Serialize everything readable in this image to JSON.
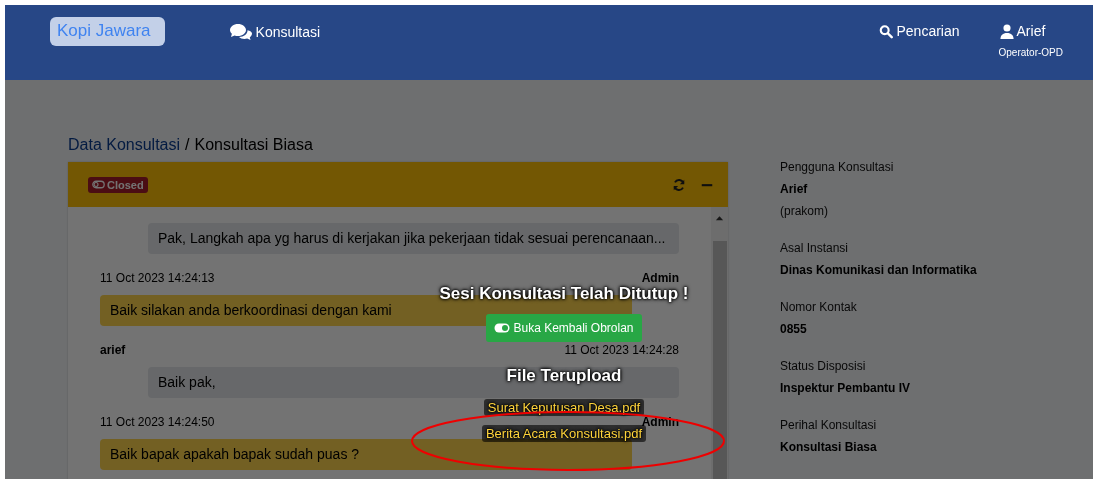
{
  "navbar": {
    "brand": "Kopi Jawara",
    "nav": [
      {
        "label": "Konsultasi",
        "kind": "chat"
      }
    ],
    "search": {
      "label": "Pencarian"
    },
    "user": {
      "name": "Arief",
      "role": "Operator-OPD"
    }
  },
  "breadcrumb": {
    "parent": "Data Konsultasi",
    "separator": "/",
    "current": "Konsultasi Biasa"
  },
  "card": {
    "status": {
      "label": "Closed",
      "kind": "closed"
    },
    "messages": [
      {
        "kind": "user",
        "text": "Pak, Langkah apa yg harus di kerjakan jika pekerjaan tidak sesuai perencanaan..."
      },
      {
        "kind": "admin",
        "sender": "Admin",
        "time": "11 Oct 2023 14:24:13",
        "text": "Baik silakan anda berkoordinasi dengan kami"
      },
      {
        "kind": "user",
        "sender": "arief",
        "time": "11 Oct 2023 14:24:28",
        "text": "Baik pak,"
      },
      {
        "kind": "admin",
        "sender": "Admin",
        "time": "11 Oct 2023 14:24:50",
        "text": "Baik bapak apakah bapak sudah puas ?"
      }
    ]
  },
  "details": [
    {
      "label": "Pengguna Konsultasi",
      "value": "Arief",
      "note": "(prakom)"
    },
    {
      "label": "Asal Instansi",
      "value": "Dinas Komunikasi dan Informatika"
    },
    {
      "label": "Nomor Kontak",
      "value": "0855"
    },
    {
      "label": "Status Disposisi",
      "value": "Inspektur Pembantu IV"
    },
    {
      "label": "Perihal Konsultasi",
      "value": "Konsultasi Biasa"
    }
  ],
  "overlay": {
    "title": "Sesi Konsultasi Telah Ditutup !",
    "reopen_button": "Buka Kembali Obrolan",
    "files_title": "File Terupload",
    "files": [
      {
        "name": "Surat Keputusan Desa.pdf",
        "highlighted": false
      },
      {
        "name": "Berita Acara Konsultasi.pdf",
        "highlighted": true
      }
    ]
  }
}
